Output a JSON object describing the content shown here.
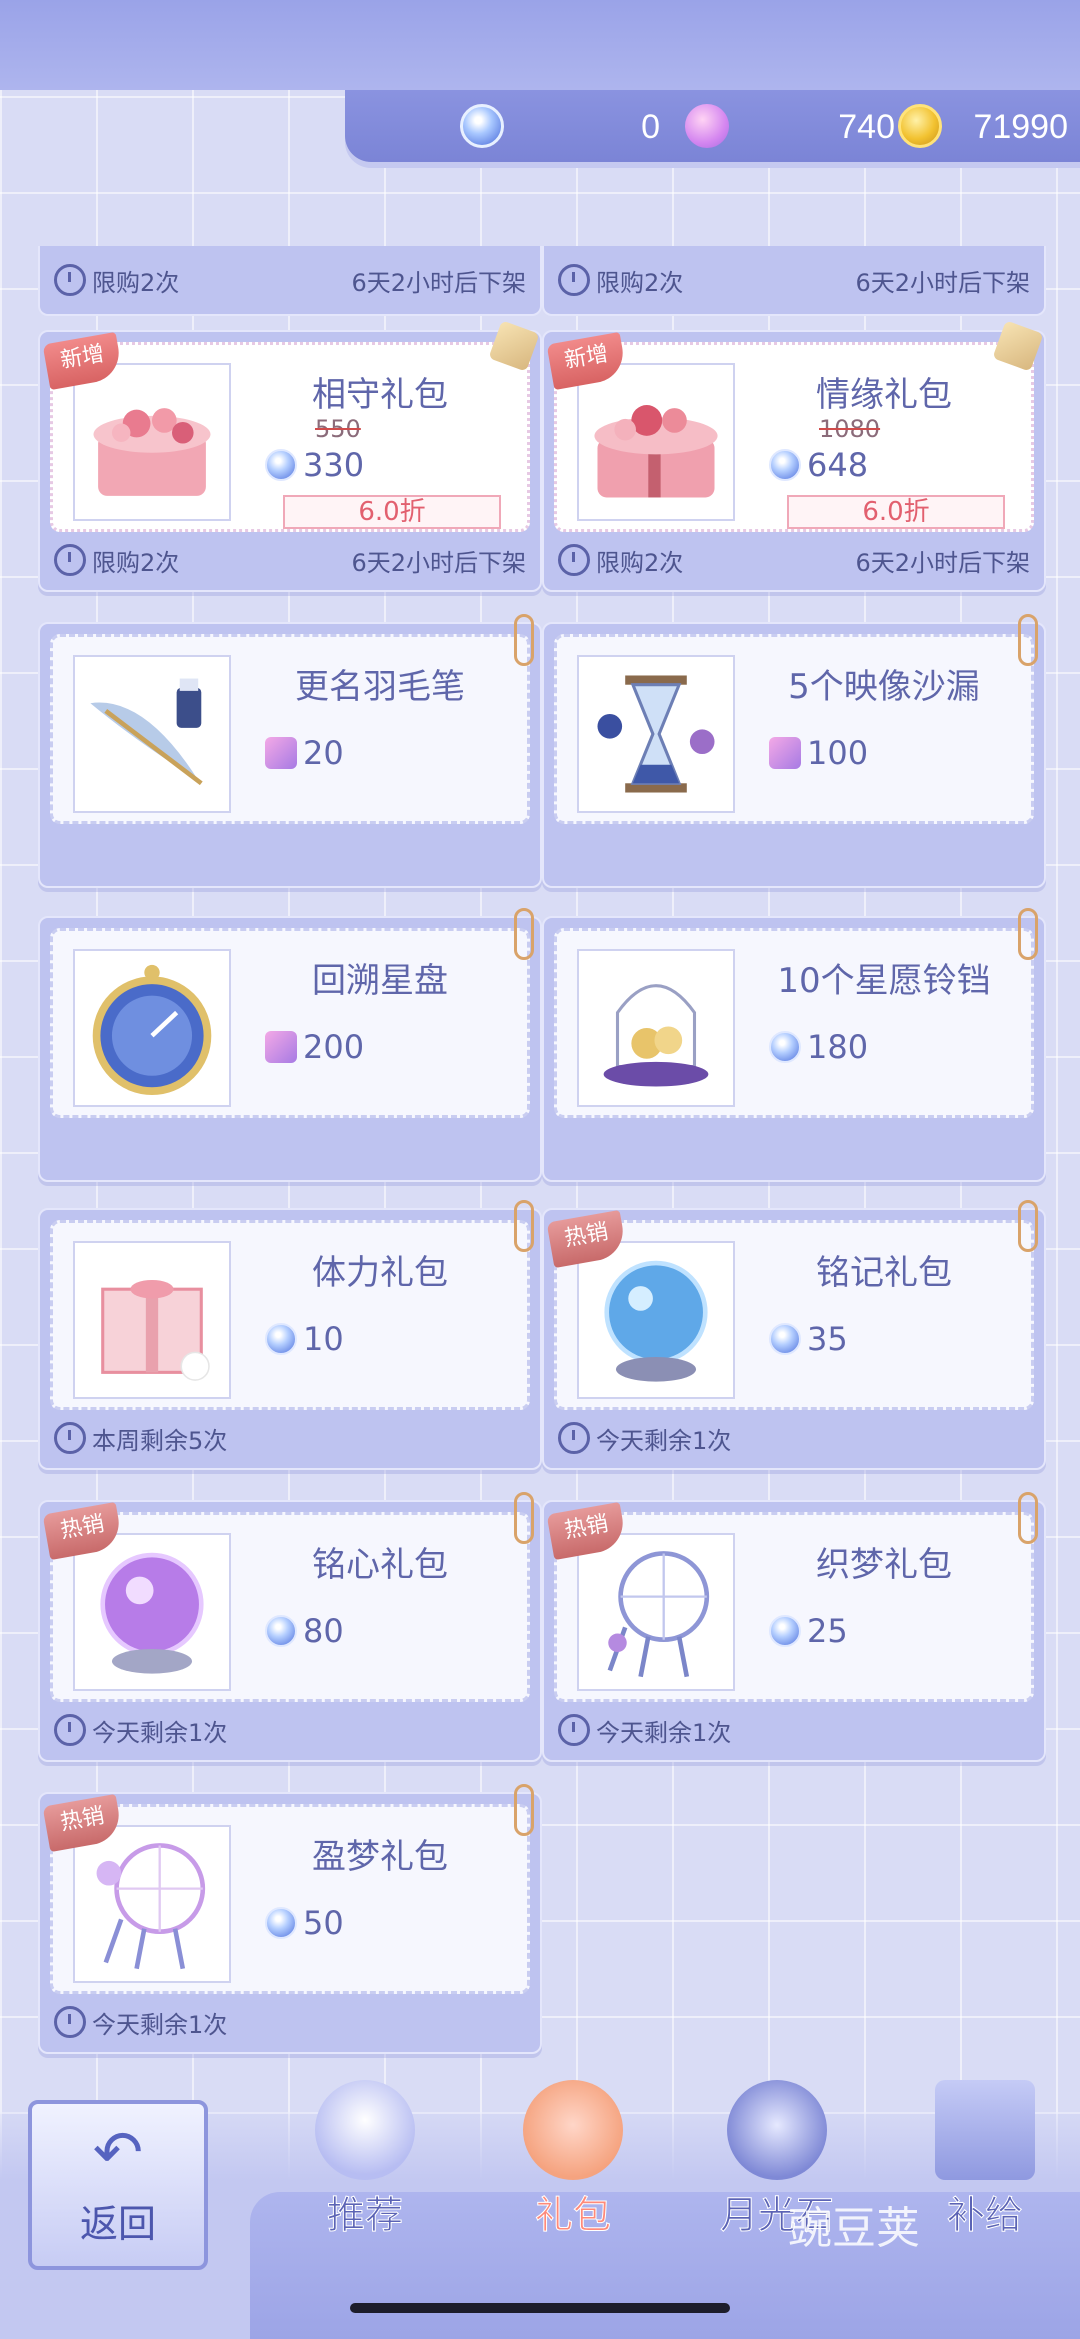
{
  "currency": {
    "gem": "0",
    "swan": "740",
    "coin": "71990"
  },
  "partial_row": [
    {
      "limit": "限购2次",
      "timer": "6天2小时后下架"
    },
    {
      "limit": "限购2次",
      "timer": "6天2小时后下架"
    }
  ],
  "items": [
    {
      "title": "相守礼包",
      "orig": "550",
      "price": "330",
      "currency_icon": "gem-icon",
      "discount": "6.0折",
      "badge": "新增",
      "limit": "限购2次",
      "timer": "6天2小时后下架"
    },
    {
      "title": "情缘礼包",
      "orig": "1080",
      "price": "648",
      "currency_icon": "gem-icon",
      "discount": "6.0折",
      "badge": "新增",
      "limit": "限购2次",
      "timer": "6天2小时后下架"
    },
    {
      "title": "更名羽毛笔",
      "price": "20",
      "currency_icon": "swan-icon"
    },
    {
      "title": "5个映像沙漏",
      "price": "100",
      "currency_icon": "swan-icon"
    },
    {
      "title": "回溯星盘",
      "price": "200",
      "currency_icon": "swan-icon"
    },
    {
      "title": "10个星愿铃铛",
      "price": "180",
      "currency_icon": "gem-icon"
    },
    {
      "title": "体力礼包",
      "price": "10",
      "currency_icon": "gem-icon",
      "limit": "本周剩余5次"
    },
    {
      "title": "铭记礼包",
      "price": "35",
      "currency_icon": "gem-icon",
      "badge": "热销",
      "limit": "今天剩余1次"
    },
    {
      "title": "铭心礼包",
      "price": "80",
      "currency_icon": "gem-icon",
      "badge": "热销",
      "limit": "今天剩余1次"
    },
    {
      "title": "织梦礼包",
      "price": "25",
      "currency_icon": "gem-icon",
      "badge": "热销",
      "limit": "今天剩余1次"
    },
    {
      "title": "盈梦礼包",
      "price": "50",
      "currency_icon": "gem-icon",
      "badge": "热销",
      "limit": "今天剩余1次"
    }
  ],
  "nav": {
    "back": "返回",
    "tabs": [
      "推荐",
      "礼包",
      "月光石",
      "补给"
    ],
    "active_tab": "礼包"
  },
  "watermark": "豌豆荚"
}
